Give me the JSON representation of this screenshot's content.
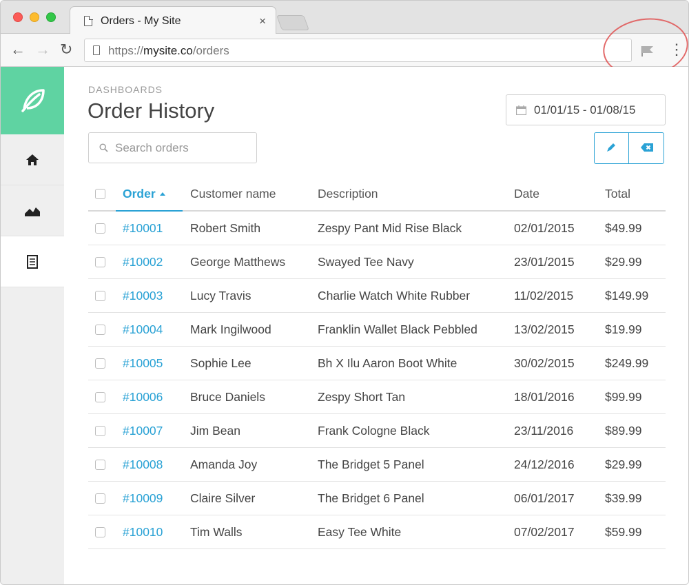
{
  "browser": {
    "tab_title": "Orders - My Site",
    "tab_close": "×",
    "url_prefix": "https://",
    "url_domain": "mysite.co",
    "url_path": "/orders"
  },
  "page": {
    "eyebrow": "DASHBOARDS",
    "title": "Order History",
    "search_placeholder": "Search orders",
    "date_range": "01/01/15 - 01/08/15"
  },
  "colors": {
    "accent": "#2aa2d5",
    "brand": "#5fd3a2"
  },
  "table": {
    "headers": {
      "order": "Order",
      "customer": "Customer name",
      "description": "Description",
      "date": "Date",
      "total": "Total"
    },
    "rows": [
      {
        "order": "#10001",
        "customer": "Robert Smith",
        "description": "Zespy Pant Mid Rise Black",
        "date": "02/01/2015",
        "total": "$49.99"
      },
      {
        "order": "#10002",
        "customer": "George Matthews",
        "description": "Swayed Tee Navy",
        "date": "23/01/2015",
        "total": "$29.99"
      },
      {
        "order": "#10003",
        "customer": "Lucy Travis",
        "description": "Charlie Watch White Rubber",
        "date": "11/02/2015",
        "total": "$149.99"
      },
      {
        "order": "#10004",
        "customer": "Mark Ingilwood",
        "description": "Franklin Wallet Black Pebbled",
        "date": "13/02/2015",
        "total": "$19.99"
      },
      {
        "order": "#10005",
        "customer": "Sophie Lee",
        "description": "Bh X Ilu Aaron Boot White",
        "date": "30/02/2015",
        "total": "$249.99"
      },
      {
        "order": "#10006",
        "customer": "Bruce Daniels",
        "description": "Zespy Short Tan",
        "date": "18/01/2016",
        "total": "$99.99"
      },
      {
        "order": "#10007",
        "customer": "Jim Bean",
        "description": "Frank Cologne Black",
        "date": "23/11/2016",
        "total": "$89.99"
      },
      {
        "order": "#10008",
        "customer": "Amanda Joy",
        "description": "The Bridget 5 Panel",
        "date": "24/12/2016",
        "total": "$29.99"
      },
      {
        "order": "#10009",
        "customer": "Claire Silver",
        "description": "The Bridget 6 Panel",
        "date": "06/01/2017",
        "total": "$39.99"
      },
      {
        "order": "#10010",
        "customer": "Tim Walls",
        "description": "Easy Tee White",
        "date": "07/02/2017",
        "total": "$59.99"
      }
    ]
  }
}
